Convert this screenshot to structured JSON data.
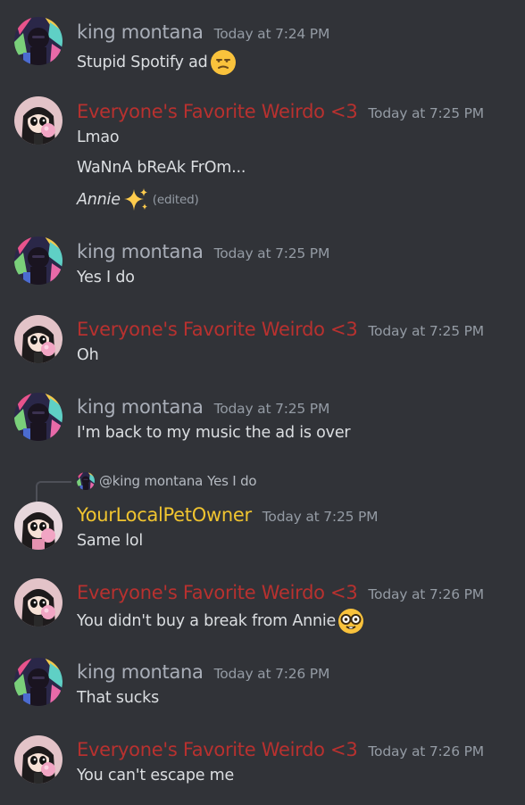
{
  "colors": {
    "background": "#313338",
    "king_montana": "#a9aeb8",
    "weirdo": "#b8312f",
    "petowner": "#f0c430",
    "text": "#dbdee1",
    "muted": "#949ba4"
  },
  "messages": [
    {
      "author": "king montana",
      "timestamp": "Today at 7:24 PM",
      "lines": [
        "Stupid Spotify ad"
      ],
      "emoji": "unamused-face-emoji"
    },
    {
      "author": "Everyone's Favorite Weirdo <3",
      "timestamp": "Today at 7:25 PM",
      "lines": [
        "Lmao",
        "WaNnA bReAk FrOm...",
        "Annie"
      ],
      "emoji": "sparkles-emoji",
      "edited": "(edited)"
    },
    {
      "author": "king montana",
      "timestamp": "Today at 7:25 PM",
      "lines": [
        "Yes I do"
      ]
    },
    {
      "author": "Everyone's Favorite Weirdo <3",
      "timestamp": "Today at 7:25 PM",
      "lines": [
        "Oh"
      ]
    },
    {
      "author": "king montana",
      "timestamp": "Today at 7:25 PM",
      "lines": [
        "I'm back to my music the ad is over"
      ]
    },
    {
      "reply_to": {
        "user": "@king montana",
        "text": "Yes I do"
      },
      "author": "YourLocalPetOwner",
      "timestamp": "Today at 7:25 PM",
      "lines": [
        "Same lol"
      ]
    },
    {
      "author": "Everyone's Favorite Weirdo <3",
      "timestamp": "Today at 7:26 PM",
      "lines": [
        "You didn't buy a break from Annie"
      ],
      "emoji": "nerd-face-emoji"
    },
    {
      "author": "king montana",
      "timestamp": "Today at 7:26 PM",
      "lines": [
        "That sucks"
      ]
    },
    {
      "author": "Everyone's Favorite Weirdo <3",
      "timestamp": "Today at 7:26 PM",
      "lines": [
        "You can't escape me"
      ]
    }
  ]
}
